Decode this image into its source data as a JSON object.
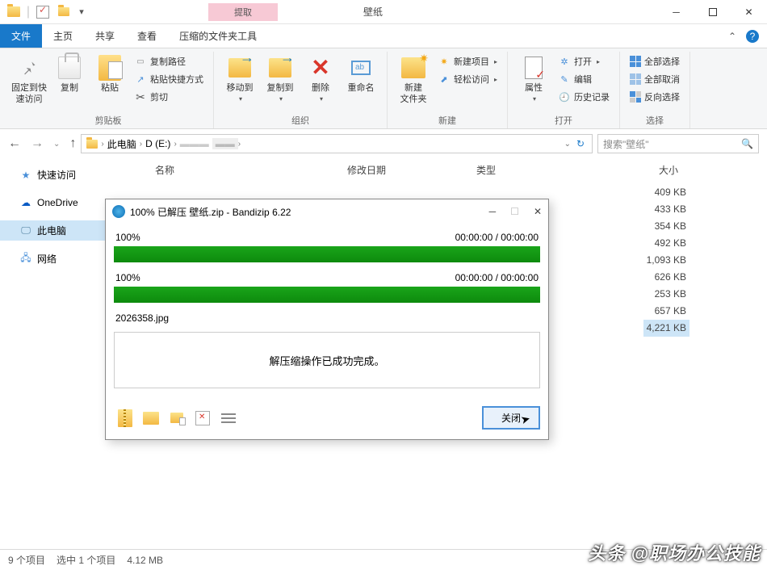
{
  "titlebar": {
    "title": "壁纸"
  },
  "tabs": {
    "file": "文件",
    "home": "主页",
    "share": "共享",
    "view": "查看",
    "context_super": "提取",
    "context_tool": "压缩的文件夹工具"
  },
  "ribbon": {
    "group_clipboard": {
      "pin": "固定到快\n速访问",
      "copy": "复制",
      "paste": "粘贴",
      "copy_path": "复制路径",
      "paste_shortcut": "粘贴快捷方式",
      "cut": "剪切",
      "label": "剪贴板"
    },
    "group_organize": {
      "move_to": "移动到",
      "copy_to": "复制到",
      "delete": "删除",
      "rename": "重命名",
      "label": "组织"
    },
    "group_new": {
      "new_folder": "新建\n文件夹",
      "new_item": "新建项目",
      "easy_access": "轻松访问",
      "label": "新建"
    },
    "group_open": {
      "properties": "属性",
      "open": "打开",
      "edit": "编辑",
      "history": "历史记录",
      "label": "打开"
    },
    "group_select": {
      "select_all": "全部选择",
      "select_none": "全部取消",
      "invert": "反向选择",
      "label": "选择"
    }
  },
  "nav": {
    "breadcrumb": {
      "pc": "此电脑",
      "drive": "D (E:)",
      "folder": "壁纸"
    },
    "search_placeholder": "搜索\"壁纸\""
  },
  "sidebar": {
    "quick": "快速访问",
    "onedrive": "OneDrive",
    "pc": "此电脑",
    "network": "网络"
  },
  "columns": {
    "name": "名称",
    "date": "修改日期",
    "type": "类型",
    "size": "大小"
  },
  "sizes": [
    "409 KB",
    "433 KB",
    "354 KB",
    "492 KB",
    "1,093 KB",
    "626 KB",
    "253 KB",
    "657 KB",
    "4,221 KB"
  ],
  "dialog": {
    "title": "100% 已解压 壁纸.zip - Bandizip 6.22",
    "p1_pct": "100%",
    "p1_time": "00:00:00 / 00:00:00",
    "p2_pct": "100%",
    "p2_time": "00:00:00 / 00:00:00",
    "current_file": "2026358.jpg",
    "message": "解压缩操作已成功完成。",
    "close": "关闭"
  },
  "statusbar": {
    "items": "9 个项目",
    "selected": "选中 1 个项目",
    "size": "4.12 MB"
  },
  "watermark": "头条 @职场办公技能"
}
